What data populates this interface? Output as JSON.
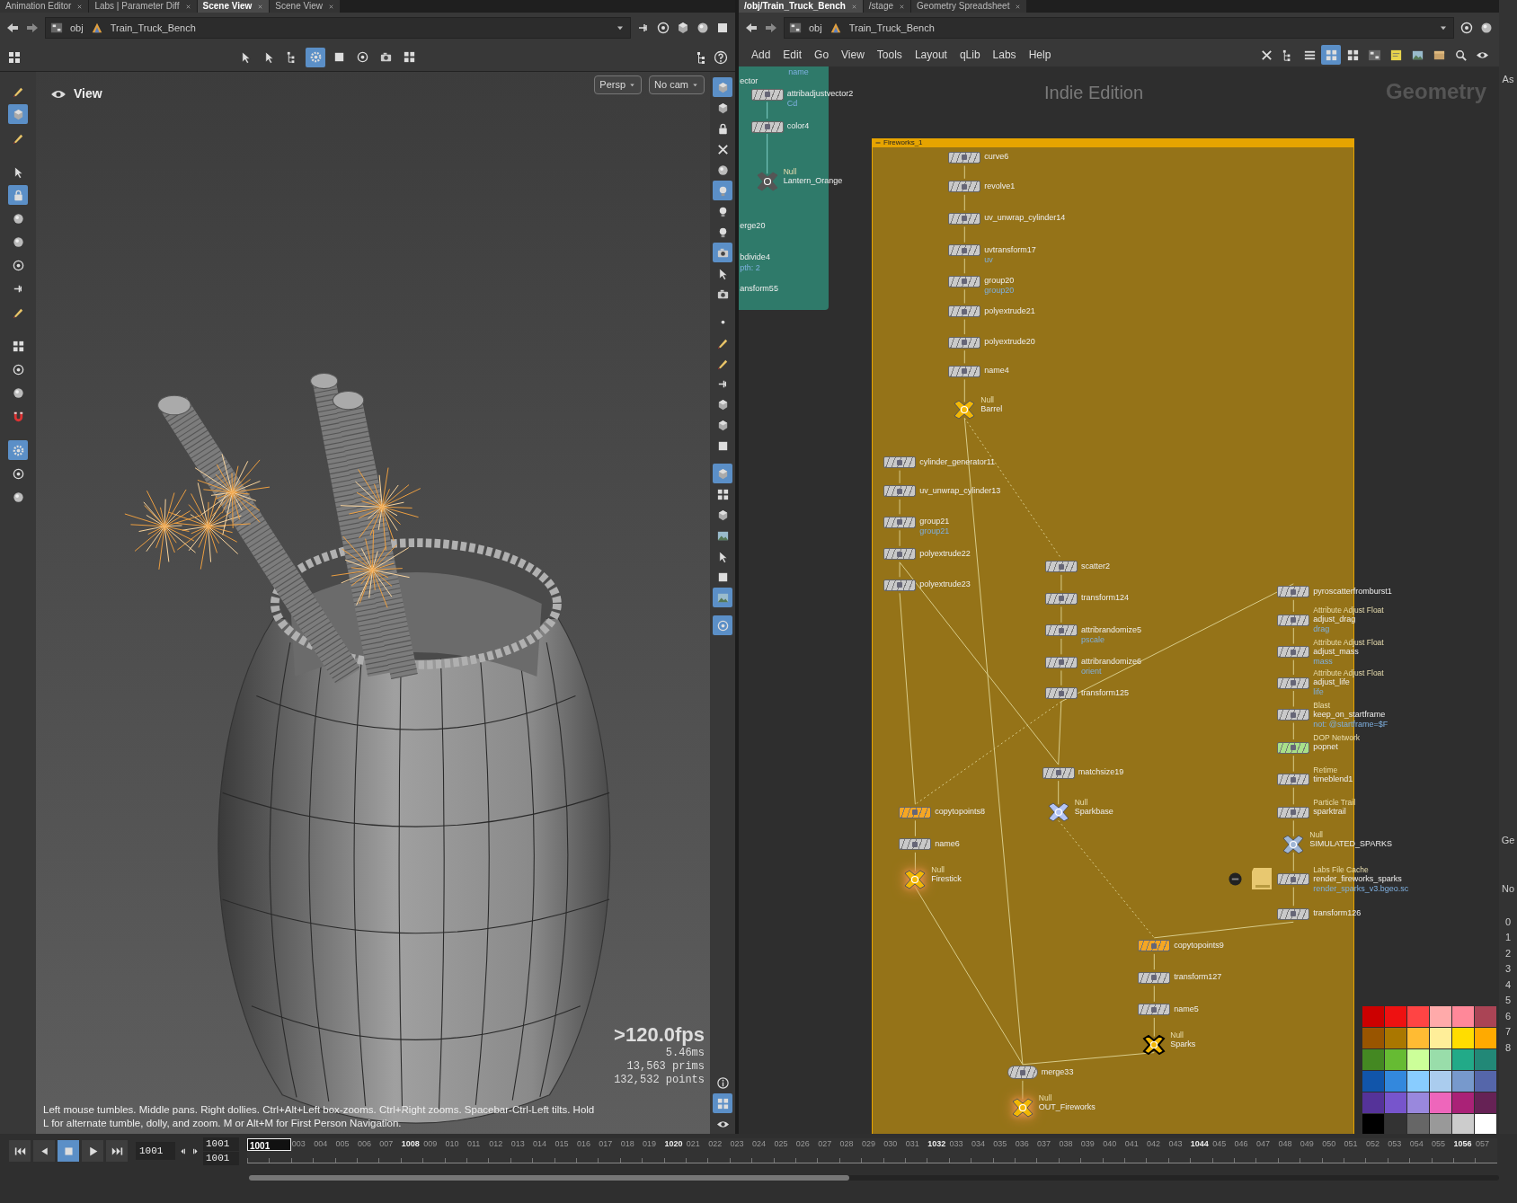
{
  "left_tabs": [
    {
      "label": "Animation Editor",
      "selected": false
    },
    {
      "label": "Labs | Parameter Diff",
      "selected": false
    },
    {
      "label": "Scene View",
      "selected": true
    },
    {
      "label": "Scene View",
      "selected": false
    }
  ],
  "right_tabs": [
    {
      "label": "/obj/Train_Truck_Bench",
      "selected": true
    },
    {
      "label": "/stage",
      "selected": false
    },
    {
      "label": "Geometry Spreadsheet",
      "selected": false
    }
  ],
  "left_path": [
    "obj",
    "Train_Truck_Bench"
  ],
  "right_path": [
    "obj",
    "Train_Truck_Bench"
  ],
  "viewport_toolbar": [
    {
      "kind": "pointer",
      "selected": false
    },
    {
      "kind": "pointer",
      "selected": false
    },
    {
      "kind": "tree",
      "selected": false
    },
    {
      "kind": "gear",
      "selected": true
    },
    {
      "kind": "square",
      "selected": false
    },
    {
      "kind": "target",
      "selected": false
    },
    {
      "kind": "camera",
      "selected": false
    },
    {
      "kind": "grid",
      "selected": false
    }
  ],
  "left_tools": [
    {
      "kind": "brush",
      "selected": false
    },
    {
      "kind": "cube",
      "selected": true
    },
    {
      "kind": "brush",
      "selected": false
    },
    {
      "kind": "pointer",
      "selected": false
    },
    {
      "kind": "lock",
      "selected": true
    },
    {
      "kind": "sphere",
      "selected": false
    },
    {
      "kind": "sphere",
      "selected": false
    },
    {
      "kind": "target",
      "selected": false
    },
    {
      "kind": "pin",
      "selected": false
    },
    {
      "kind": "brush",
      "selected": false
    },
    {
      "kind": "grid",
      "selected": false
    },
    {
      "kind": "target",
      "selected": false
    },
    {
      "kind": "sphere",
      "selected": false
    },
    {
      "kind": "magnet",
      "selected": false
    },
    {
      "kind": "gear",
      "selected": true
    },
    {
      "kind": "target",
      "selected": false
    },
    {
      "kind": "sphere",
      "selected": false
    }
  ],
  "right_tools": [
    {
      "kind": "cube",
      "selected": true
    },
    {
      "kind": "cube",
      "selected": false
    },
    {
      "kind": "lock",
      "selected": false
    },
    {
      "kind": "cross",
      "selected": false
    },
    {
      "kind": "sphere",
      "selected": false
    },
    {
      "kind": "bulb",
      "selected": true
    },
    {
      "kind": "bulb",
      "selected": false
    },
    {
      "kind": "bulb",
      "selected": false
    },
    {
      "kind": "camera",
      "selected": true
    },
    {
      "kind": "pointer",
      "selected": false
    },
    {
      "kind": "camera",
      "selected": false
    },
    {
      "kind": "dot",
      "selected": false
    },
    {
      "kind": "brush",
      "selected": false
    },
    {
      "kind": "brush",
      "selected": false
    },
    {
      "kind": "pin",
      "selected": false
    },
    {
      "kind": "cube",
      "selected": false
    },
    {
      "kind": "cube",
      "selected": false
    },
    {
      "kind": "square",
      "selected": false
    },
    {
      "kind": "cube",
      "selected": true
    },
    {
      "kind": "grid",
      "selected": false
    },
    {
      "kind": "cube",
      "selected": false
    },
    {
      "kind": "image",
      "selected": false
    },
    {
      "kind": "pointer",
      "selected": false
    },
    {
      "kind": "square",
      "selected": false
    },
    {
      "kind": "image",
      "selected": true
    },
    {
      "kind": "target",
      "selected": true
    }
  ],
  "right_tools_bottom": [
    {
      "kind": "info",
      "selected": false
    },
    {
      "kind": "grid",
      "selected": true
    },
    {
      "kind": "eye",
      "selected": false
    }
  ],
  "viewport": {
    "title": "View",
    "camera_buttons": [
      "Persp",
      "No cam"
    ],
    "fps": ">120.0fps",
    "frame_time": "5.46ms",
    "prims": "13,563 prims",
    "points": "132,532 points",
    "hint": "Left mouse tumbles. Middle pans. Right dollies. Ctrl+Alt+Left box-zooms. Ctrl+Right zooms. Spacebar-Ctrl-Left tilts. Hold L for alternate tumble, dolly, and zoom. M or Alt+M for First Person Navigation."
  },
  "network": {
    "menu": [
      "Add",
      "Edit",
      "Go",
      "View",
      "Tools",
      "Layout",
      "qLib",
      "Labs",
      "Help"
    ],
    "tools": [
      {
        "kind": "cross",
        "selected": false
      },
      {
        "kind": "tree",
        "selected": false
      },
      {
        "kind": "list",
        "selected": false
      },
      {
        "kind": "grid",
        "selected": true
      },
      {
        "kind": "grid",
        "selected": false
      },
      {
        "kind": "network",
        "selected": false
      },
      {
        "kind": "note",
        "selected": false
      },
      {
        "kind": "image",
        "selected": false
      },
      {
        "kind": "box",
        "selected": false
      },
      {
        "kind": "search",
        "selected": false
      },
      {
        "kind": "eye",
        "selected": false
      }
    ],
    "edition": "Indie Edition",
    "context": "Geometry",
    "subnet_fragments": [
      {
        "text": "name",
        "kind": "param"
      },
      {
        "text": "ector",
        "kind": "label"
      },
      {
        "text": "erge20",
        "kind": "label"
      },
      {
        "text": "bdivide4",
        "kind": "label"
      },
      {
        "text": "pth: 2",
        "kind": "param"
      },
      {
        "text": "ansform55",
        "kind": "label"
      }
    ],
    "subnet_nodes": [
      {
        "name": "attribadjustvector2",
        "kind": "sop",
        "param": "Cd",
        "color": "#c9c9c9",
        "selected": false,
        "flagged": false
      },
      {
        "name": "color4",
        "kind": "sop",
        "color": "#c9c9c9",
        "selected": false,
        "flagged": false
      },
      {
        "name": "Lantern_Orange",
        "type": "Null",
        "kind": "null",
        "color": "#555555",
        "selected": false,
        "flagged": false
      }
    ],
    "group_title": "Fireworks_1",
    "nodes": [
      {
        "name": "curve6",
        "kind": "sop",
        "color": "#c9c9c9",
        "selected": false,
        "flagged": false
      },
      {
        "name": "revolve1",
        "kind": "sop",
        "color": "#c9c9c9",
        "selected": false,
        "flagged": false
      },
      {
        "name": "uv_unwrap_cylinder14",
        "kind": "sop",
        "color": "#c9c9c9",
        "selected": false,
        "flagged": false
      },
      {
        "name": "uvtransform17",
        "kind": "sop",
        "param": "uv",
        "color": "#c9c9c9",
        "selected": false,
        "flagged": false
      },
      {
        "name": "group20",
        "kind": "sop",
        "param": "group20",
        "color": "#c9c9c9",
        "selected": false,
        "flagged": false
      },
      {
        "name": "polyextrude21",
        "kind": "sop",
        "color": "#c9c9c9",
        "selected": false,
        "flagged": false
      },
      {
        "name": "polyextrude20",
        "kind": "sop",
        "color": "#c9c9c9",
        "selected": false,
        "flagged": false
      },
      {
        "name": "name4",
        "kind": "sop",
        "color": "#c9c9c9",
        "selected": false,
        "flagged": false
      },
      {
        "name": "Barrel",
        "type": "Null",
        "kind": "null",
        "color": "#f2b705",
        "selected": false,
        "flagged": false
      },
      {
        "name": "cylinder_generator11",
        "kind": "sop",
        "color": "#c9c9c9",
        "selected": false,
        "flagged": false
      },
      {
        "name": "uv_unwrap_cylinder13",
        "kind": "sop",
        "color": "#c9c9c9",
        "selected": false,
        "flagged": false
      },
      {
        "name": "group21",
        "kind": "sop",
        "param": "group21",
        "color": "#c9c9c9",
        "selected": false,
        "flagged": false
      },
      {
        "name": "polyextrude22",
        "kind": "sop",
        "color": "#c9c9c9",
        "selected": false,
        "flagged": false
      },
      {
        "name": "polyextrude23",
        "kind": "sop",
        "color": "#c9c9c9",
        "selected": false,
        "flagged": false
      },
      {
        "name": "scatter2",
        "kind": "sop",
        "color": "#c9c9c9",
        "selected": false,
        "flagged": false
      },
      {
        "name": "transform124",
        "kind": "sop",
        "color": "#c9c9c9",
        "selected": false,
        "flagged": false
      },
      {
        "name": "attribrandomize5",
        "kind": "sop",
        "param": "pscale",
        "color": "#c9c9c9",
        "selected": false,
        "flagged": false
      },
      {
        "name": "attribrandomize6",
        "kind": "sop",
        "param": "orient",
        "color": "#c9c9c9",
        "selected": false,
        "flagged": false
      },
      {
        "name": "transform125",
        "kind": "sop",
        "color": "#c9c9c9",
        "selected": false,
        "flagged": false
      },
      {
        "name": "pyroscatterfromburst1",
        "kind": "sop",
        "color": "#c9c9c9",
        "selected": false,
        "flagged": false
      },
      {
        "name": "adjust_drag",
        "type": "Attribute Adjust Float",
        "kind": "sop",
        "param": "drag",
        "color": "#c9c9c9",
        "selected": false,
        "flagged": false
      },
      {
        "name": "adjust_mass",
        "type": "Attribute Adjust Float",
        "kind": "sop",
        "param": "mass",
        "color": "#c9c9c9",
        "selected": false,
        "flagged": false
      },
      {
        "name": "adjust_life",
        "type": "Attribute Adjust Float",
        "kind": "sop",
        "param": "life",
        "color": "#c9c9c9",
        "selected": false,
        "flagged": false
      },
      {
        "name": "keep_on_startframe",
        "type": "Blast",
        "kind": "sop",
        "param": "not: @startframe=$F",
        "color": "#c9c9c9",
        "selected": false,
        "flagged": false
      },
      {
        "name": "popnet",
        "type": "DOP Network",
        "kind": "sop",
        "color": "#a8e08a",
        "selected": false,
        "flagged": false
      },
      {
        "name": "timeblend1",
        "type": "Retime",
        "kind": "sop",
        "color": "#c9c9c9",
        "selected": false,
        "flagged": false
      },
      {
        "name": "sparktrail",
        "type": "Particle Trail",
        "kind": "sop",
        "color": "#c9c9c9",
        "selected": false,
        "flagged": false
      },
      {
        "name": "SIMULATED_SPARKS",
        "type": "Null",
        "kind": "null",
        "color": "#9fb6d6",
        "selected": false,
        "flagged": false
      },
      {
        "name": "render_fireworks_sparks",
        "type": "Labs File Cache",
        "kind": "filecache",
        "param": "render_sparks_v3.bgeo.sc",
        "color": "#c9c9c9",
        "selected": false,
        "flagged": false
      },
      {
        "name": "transform126",
        "kind": "sop",
        "color": "#c9c9c9",
        "selected": false,
        "flagged": false
      },
      {
        "name": "matchsize19",
        "kind": "sop",
        "color": "#c9c9c9",
        "selected": false,
        "flagged": false
      },
      {
        "name": "copytopoints8",
        "kind": "sop",
        "color": "#f5a623",
        "selected": false,
        "flagged": false
      },
      {
        "name": "Sparkbase",
        "type": "Null",
        "kind": "null",
        "color": "#b3c4f5",
        "selected": false,
        "flagged": false
      },
      {
        "name": "name6",
        "kind": "sop",
        "color": "#c9c9c9",
        "selected": false,
        "flagged": false
      },
      {
        "name": "Firestick",
        "type": "Null",
        "kind": "null",
        "color": "#f2b705",
        "selected": false,
        "flagged": true
      },
      {
        "name": "copytopoints9",
        "kind": "sop",
        "color": "#f5a623",
        "selected": false,
        "flagged": false
      },
      {
        "name": "transform127",
        "kind": "sop",
        "color": "#c9c9c9",
        "selected": false,
        "flagged": false
      },
      {
        "name": "name5",
        "kind": "sop",
        "color": "#c9c9c9",
        "selected": false,
        "flagged": false
      },
      {
        "name": "Sparks",
        "type": "Null",
        "kind": "null",
        "color": "#f2b705",
        "selected": true,
        "flagged": false
      },
      {
        "name": "merge33",
        "kind": "merge",
        "color": "#c9c9c9",
        "selected": false,
        "flagged": false
      },
      {
        "name": "OUT_Fireworks",
        "type": "Null",
        "kind": "null",
        "color": "#f2b705",
        "selected": false,
        "flagged": true
      }
    ],
    "palette": [
      {
        "color": "#cc0000"
      },
      {
        "color": "#ee1111"
      },
      {
        "color": "#ff4444"
      },
      {
        "color": "#ffaaaa"
      },
      {
        "color": "#ff8899"
      },
      {
        "color": "#aa4455"
      },
      {
        "color": "#995500"
      },
      {
        "color": "#aa7700"
      },
      {
        "color": "#ffbb33"
      },
      {
        "color": "#ffee99"
      },
      {
        "color": "#ffdd00"
      },
      {
        "color": "#ffaa00"
      },
      {
        "color": "#448822"
      },
      {
        "color": "#66bb33"
      },
      {
        "color": "#ccff99"
      },
      {
        "color": "#99ddaa"
      },
      {
        "color": "#22aa88"
      },
      {
        "color": "#228877"
      },
      {
        "color": "#1155aa"
      },
      {
        "color": "#3388dd"
      },
      {
        "color": "#88ccff"
      },
      {
        "color": "#aaccee"
      },
      {
        "color": "#7799cc"
      },
      {
        "color": "#5566aa"
      },
      {
        "color": "#553399"
      },
      {
        "color": "#7755cc"
      },
      {
        "color": "#9988dd"
      },
      {
        "color": "#ee66bb"
      },
      {
        "color": "#aa2277"
      },
      {
        "color": "#662255"
      },
      {
        "color": "#000000"
      },
      {
        "color": "#333333"
      },
      {
        "color": "#666666"
      },
      {
        "color": "#999999"
      },
      {
        "color": "#cccccc"
      },
      {
        "color": "#ffffff"
      }
    ]
  },
  "side_strip": [
    "As",
    "Ge",
    "No",
    "0",
    "1",
    "2",
    "3",
    "4",
    "5",
    "6",
    "7",
    "8"
  ],
  "timeline": {
    "controls": [
      {
        "kind": "first",
        "selected": false
      },
      {
        "kind": "prev",
        "selected": false
      },
      {
        "kind": "stop",
        "selected": true
      },
      {
        "kind": "play",
        "selected": false
      },
      {
        "kind": "last",
        "selected": false
      }
    ],
    "frame": "1001",
    "range_start": "1001",
    "range_end": "1001",
    "range": {
      "level": 0.48
    },
    "ruler": [
      {
        "label": "1001",
        "major": true
      },
      {
        "label": "003",
        "major": false
      },
      {
        "label": "004",
        "major": false
      },
      {
        "label": "005",
        "major": false
      },
      {
        "label": "006",
        "major": false
      },
      {
        "label": "007",
        "major": false
      },
      {
        "label": "1008",
        "major": true
      },
      {
        "label": "009",
        "major": false
      },
      {
        "label": "010",
        "major": false
      },
      {
        "label": "011",
        "major": false
      },
      {
        "label": "012",
        "major": false
      },
      {
        "label": "013",
        "major": false
      },
      {
        "label": "014",
        "major": false
      },
      {
        "label": "015",
        "major": false
      },
      {
        "label": "016",
        "major": false
      },
      {
        "label": "017",
        "major": false
      },
      {
        "label": "018",
        "major": false
      },
      {
        "label": "019",
        "major": false
      },
      {
        "label": "1020",
        "major": true
      },
      {
        "label": "021",
        "major": false
      },
      {
        "label": "022",
        "major": false
      },
      {
        "label": "023",
        "major": false
      },
      {
        "label": "024",
        "major": false
      },
      {
        "label": "025",
        "major": false
      },
      {
        "label": "026",
        "major": false
      },
      {
        "label": "027",
        "major": false
      },
      {
        "label": "028",
        "major": false
      },
      {
        "label": "029",
        "major": false
      },
      {
        "label": "030",
        "major": false
      },
      {
        "label": "031",
        "major": false
      },
      {
        "label": "1032",
        "major": true
      },
      {
        "label": "033",
        "major": false
      },
      {
        "label": "034",
        "major": false
      },
      {
        "label": "035",
        "major": false
      },
      {
        "label": "036",
        "major": false
      },
      {
        "label": "037",
        "major": false
      },
      {
        "label": "038",
        "major": false
      },
      {
        "label": "039",
        "major": false
      },
      {
        "label": "040",
        "major": false
      },
      {
        "label": "041",
        "major": false
      },
      {
        "label": "042",
        "major": false
      },
      {
        "label": "043",
        "major": false
      },
      {
        "label": "1044",
        "major": true
      },
      {
        "label": "045",
        "major": false
      },
      {
        "label": "046",
        "major": false
      },
      {
        "label": "047",
        "major": false
      },
      {
        "label": "048",
        "major": false
      },
      {
        "label": "049",
        "major": false
      },
      {
        "label": "050",
        "major": false
      },
      {
        "label": "051",
        "major": false
      },
      {
        "label": "052",
        "major": false
      },
      {
        "label": "053",
        "major": false
      },
      {
        "label": "054",
        "major": false
      },
      {
        "label": "055",
        "major": false
      },
      {
        "label": "1056",
        "major": true
      },
      {
        "label": "057",
        "major": false
      }
    ]
  }
}
